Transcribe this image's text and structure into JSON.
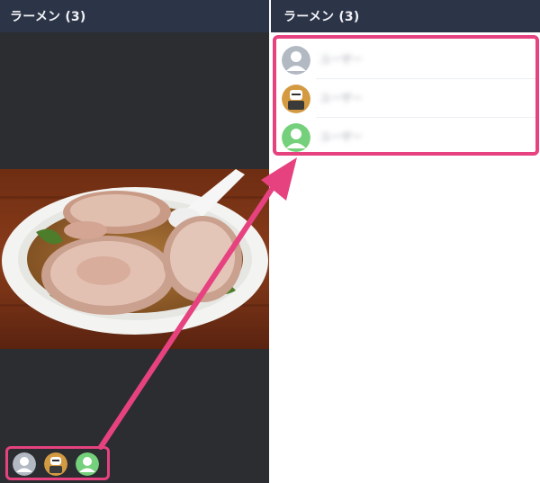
{
  "left_panel": {
    "title": "ラーメン (3)",
    "photo": {
      "subject": "chashu ramen bowl"
    },
    "reaction_avatars": [
      "default-person-avatar-gray",
      "character-avatar-orange",
      "default-person-avatar-green"
    ]
  },
  "right_panel": {
    "title": "ラーメン (3)",
    "members": [
      {
        "name": "ユーザー",
        "avatar": "default-person-avatar-gray"
      },
      {
        "name": "ユーザー",
        "avatar": "character-avatar-orange"
      },
      {
        "name": "ユーザー",
        "avatar": "default-person-avatar-green"
      }
    ]
  },
  "colors": {
    "header_bg": "#2c3447",
    "dark_bg": "#2b2d31",
    "highlight": "#e6427f",
    "avatar_gray": "#b2b9c3",
    "avatar_green": "#74d07a",
    "avatar_orange": "#d39a42"
  }
}
